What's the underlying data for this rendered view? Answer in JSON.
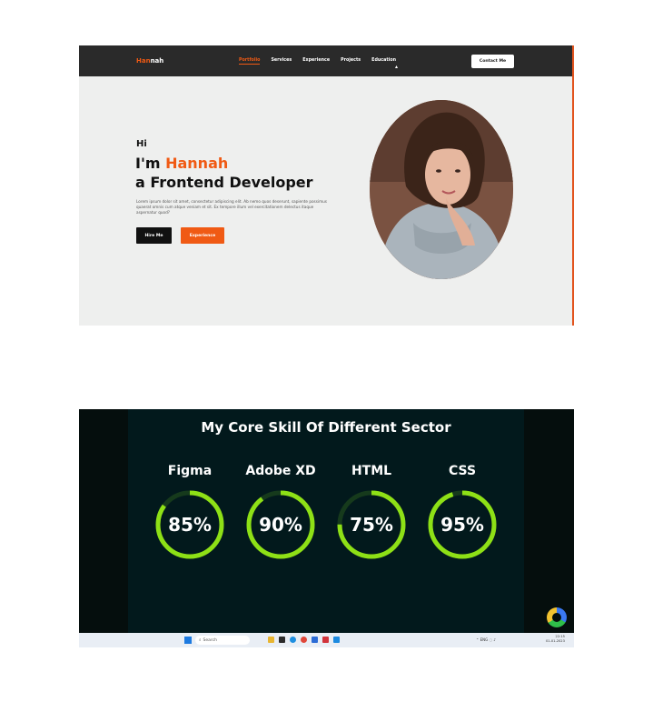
{
  "portfolio": {
    "logo_prefix": "Han",
    "logo_suffix": "nah",
    "nav": [
      "Portfolio",
      "Services",
      "Experience",
      "Projects",
      "Education"
    ],
    "active_nav_index": 0,
    "contact_button": "Contact Me",
    "greeting": "Hi",
    "intro_prefix": "I'm ",
    "name": "Hannah",
    "role": "a Frontend Developer",
    "description": "Lorem ipsum dolor sit amet, consectetur adipiscing elit. Ab nemo quos deserunt, sapiente possimus quaerat omnis cum atque veniam et sit. Ex tempore illum vel exercitationem delectus itaque aspernatur quod?",
    "hire_button": "Hire Me",
    "experience_button": "Experience",
    "colors": {
      "accent": "#f05a14",
      "nav_bg": "#2a2a2a",
      "page_bg": "#eeefee"
    }
  },
  "skills": {
    "title": "My Core Skill Of Different Sector",
    "items": [
      {
        "name": "Figma",
        "percent_label": "85%",
        "value": 85
      },
      {
        "name": "Adobe XD",
        "percent_label": "90%",
        "value": 90
      },
      {
        "name": "HTML",
        "percent_label": "75%",
        "value": 75
      },
      {
        "name": "CSS",
        "percent_label": "95%",
        "value": 95
      }
    ],
    "colors": {
      "ring": "#8ee016",
      "track": "#163a1c",
      "panel_bg": "#02191c"
    }
  },
  "taskbar": {
    "search_placeholder": "Search",
    "language": "ENG",
    "time": "22:15",
    "date": "01-01-2023",
    "icons": [
      "windows-icon",
      "file-explorer-icon",
      "edge-icon",
      "chrome-icon",
      "store-icon",
      "mail-icon",
      "vscode-icon"
    ]
  }
}
